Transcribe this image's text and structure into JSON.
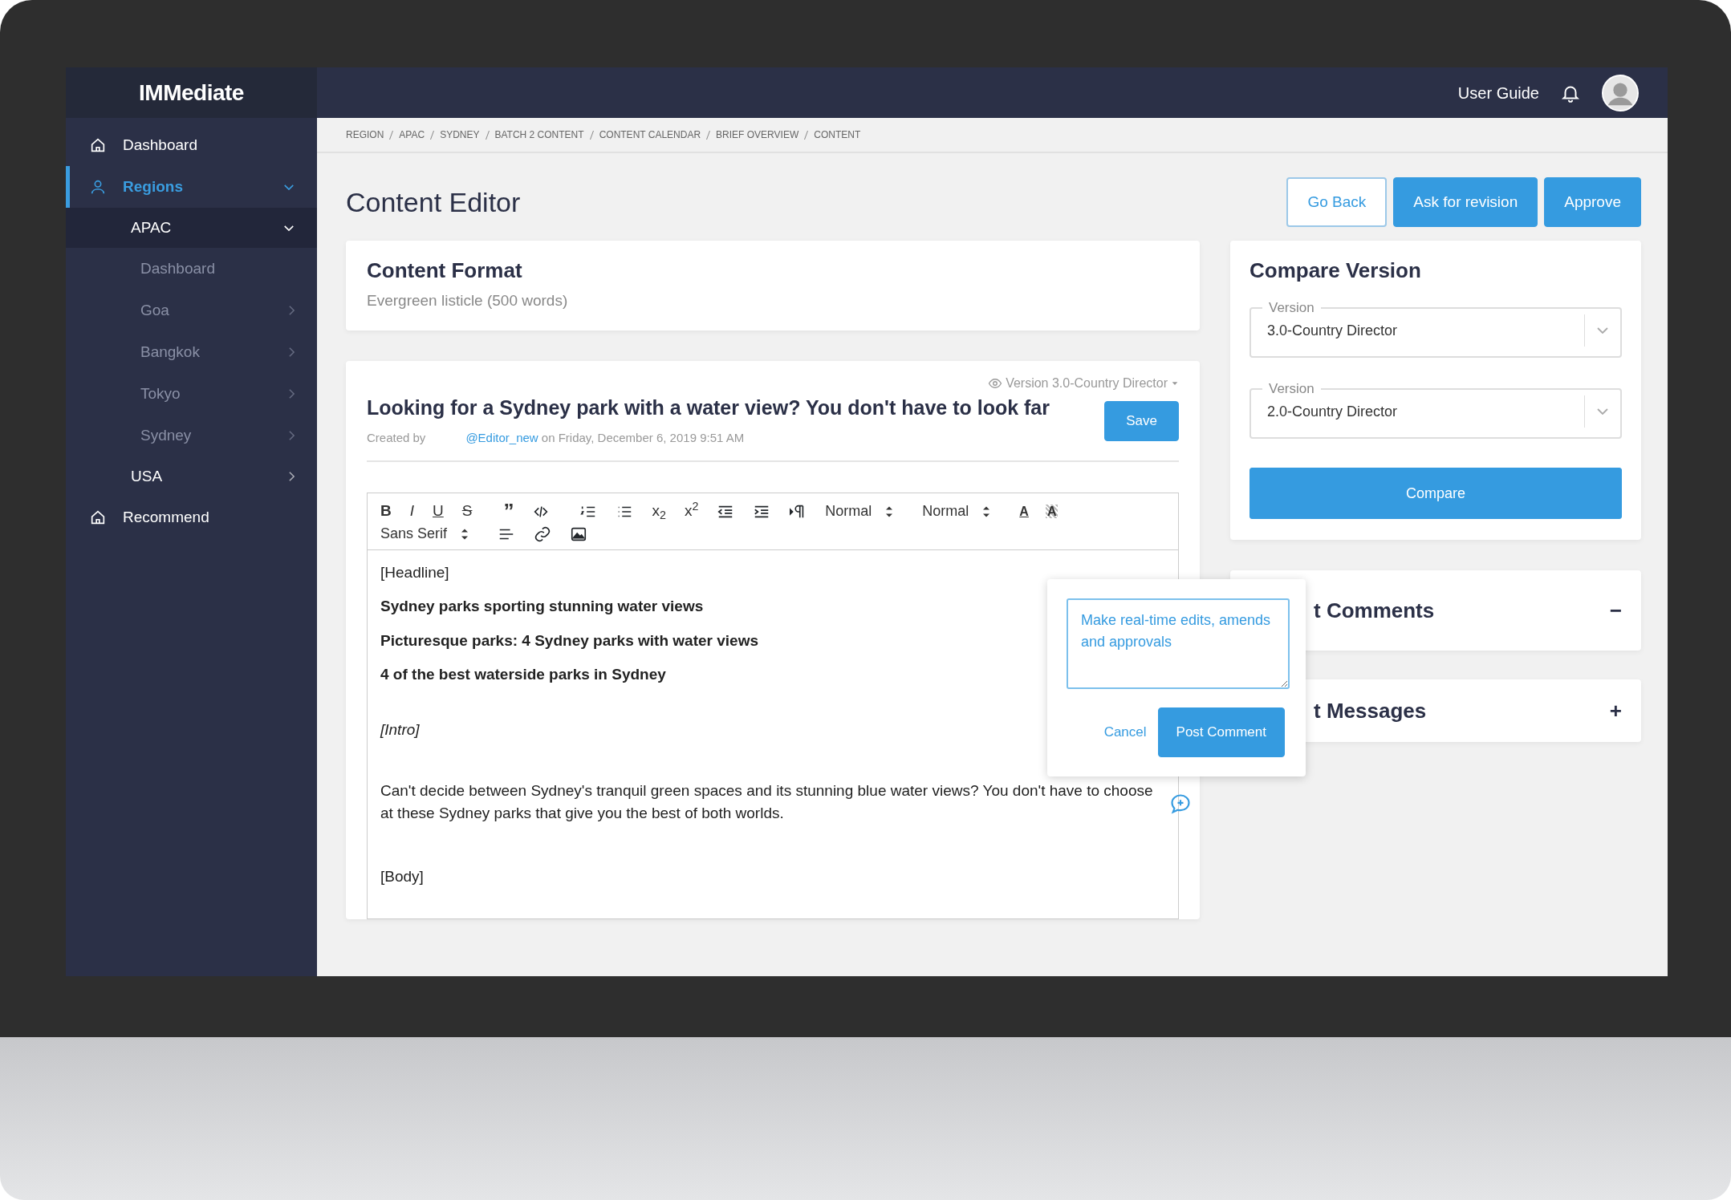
{
  "app": {
    "logo": "IMMediate"
  },
  "sidebar": {
    "items": [
      {
        "label": "Dashboard",
        "selected": false
      },
      {
        "label": "Regions",
        "selected": true,
        "expanded": true,
        "children": [
          {
            "label": "APAC",
            "selected": false,
            "expanded": true,
            "children": [
              {
                "label": "Dashboard",
                "selected": false
              },
              {
                "label": "Goa",
                "selected": false,
                "expanded": false
              },
              {
                "label": "Bangkok",
                "selected": false,
                "expanded": false
              },
              {
                "label": "Tokyo",
                "selected": false,
                "expanded": false
              },
              {
                "label": "Sydney",
                "selected": false,
                "expanded": false
              }
            ]
          },
          {
            "label": "USA",
            "selected": false,
            "expanded": false
          }
        ]
      },
      {
        "label": "Recommend",
        "selected": false
      }
    ]
  },
  "topbar": {
    "link": "User Guide"
  },
  "breadcrumb": [
    "REGION",
    "APAC",
    "SYDNEY",
    "BATCH 2 CONTENT",
    "CONTENT CALENDAR",
    "BRIEF OVERVIEW",
    "CONTENT"
  ],
  "page_title": "Content Editor",
  "actions": [
    {
      "label": "Go Back",
      "kind": "outline"
    },
    {
      "label": "Ask for revision",
      "kind": "primary"
    },
    {
      "label": "Approve",
      "kind": "primary"
    }
  ],
  "content_format": {
    "title": "Content Format",
    "value": "Evergreen listicle (500 words)"
  },
  "editor": {
    "version": "Version 3.0-Country Director",
    "title": "Looking for a Sydney park with a water view? You don't have to look far",
    "created_label": "Created by",
    "author": "@Editor_new",
    "created_on": "on Friday, December 6, 2019 9:51 AM",
    "save": "Save",
    "toolbar": [
      {
        "kind": "bold",
        "label": "B"
      },
      {
        "kind": "italic",
        "label": "I"
      },
      {
        "kind": "underline",
        "label": "U"
      },
      {
        "kind": "strike",
        "label": "S"
      },
      {
        "kind": "quote",
        "label": "”"
      },
      {
        "kind": "code"
      },
      {
        "kind": "ol"
      },
      {
        "kind": "ul"
      },
      {
        "kind": "script",
        "label": "x$_{2}$"
      },
      {
        "kind": "script",
        "label": "x$^{2}$"
      },
      {
        "kind": "outdent"
      },
      {
        "kind": "indent"
      },
      {
        "kind": "direction"
      },
      {
        "kind": "select",
        "label": "Normal"
      },
      {
        "kind": "select",
        "label": "Normal"
      },
      {
        "kind": "color",
        "label": "A"
      },
      {
        "kind": "background",
        "label": "A"
      },
      {
        "kind": "select",
        "label": "Sans Serif"
      },
      {
        "kind": "align"
      },
      {
        "kind": "link"
      },
      {
        "kind": "image"
      }
    ],
    "lines": [
      {
        "kind": "plain",
        "text": "[Headline]"
      },
      {
        "kind": "bold",
        "text": "Sydney parks sporting stunning water views"
      },
      {
        "kind": "bold",
        "text": "Picturesque parks: 4 Sydney parks with water views"
      },
      {
        "kind": "bold",
        "text": "4 of the best waterside parks in Sydney"
      },
      {
        "kind": "italic",
        "text": "[Intro]"
      },
      {
        "kind": "para",
        "text": "Can't decide between Sydney's tranquil green spaces and its stunning blue water views? You don't have to choose at these Sydney parks that give you the best of both worlds."
      },
      {
        "kind": "plain",
        "text": "[Body]"
      }
    ]
  },
  "comment_popover": {
    "value": "Make real-time edits, amends and approvals",
    "cancel": "Cancel",
    "post": "Post Comment"
  },
  "compare": {
    "title": "Compare Version",
    "selects": [
      {
        "label": "Version",
        "value": "3.0-Country Director"
      },
      {
        "label": "Version",
        "value": "2.0-Country Director"
      }
    ],
    "button": "Compare"
  },
  "panels": [
    {
      "title": "t Comments",
      "toggle": "−"
    },
    {
      "title": "t Messages",
      "toggle": "+"
    }
  ]
}
